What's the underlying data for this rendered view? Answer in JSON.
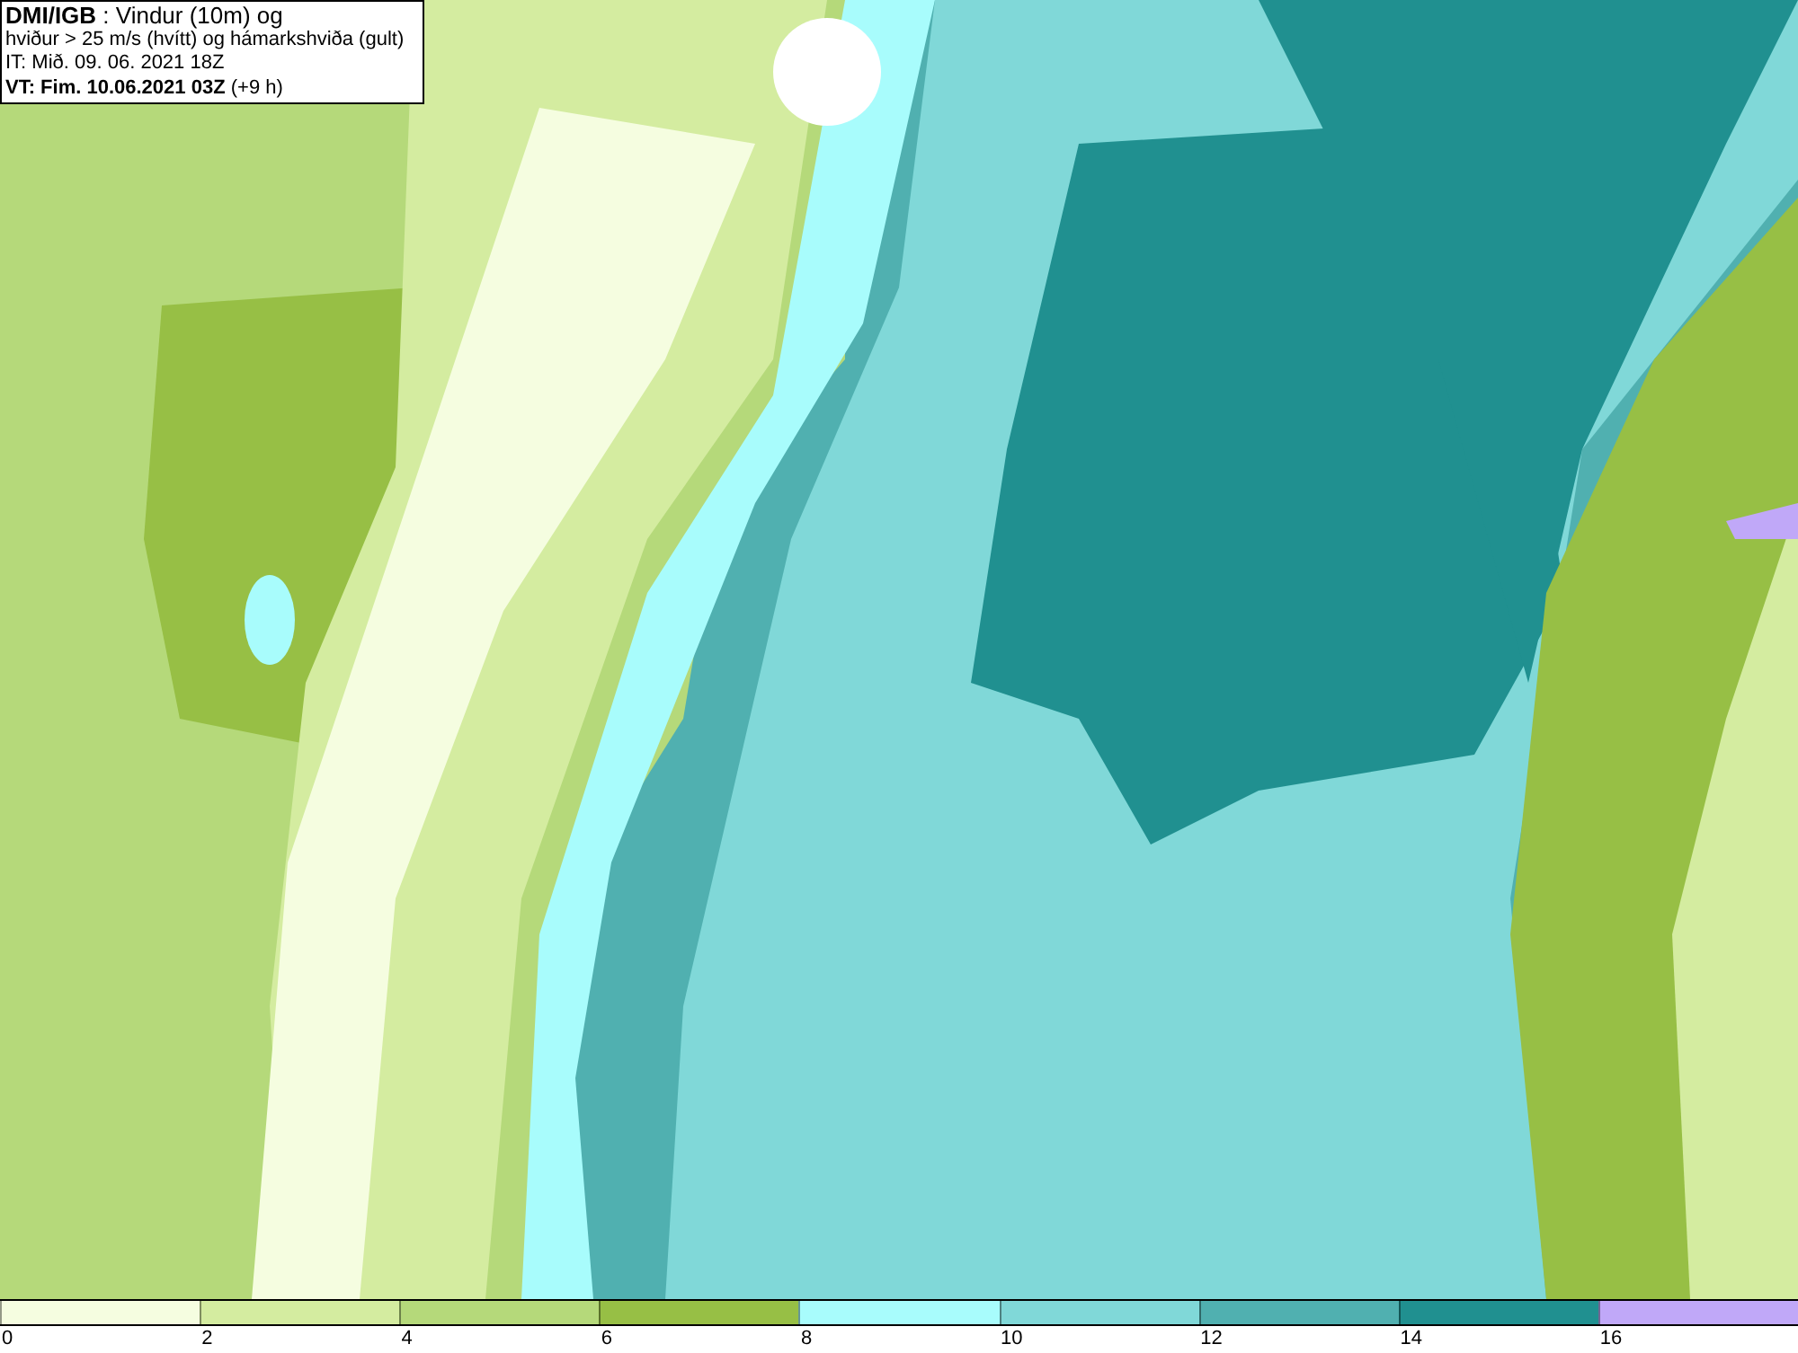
{
  "header": {
    "lines": [
      "**DMI/IGB** : Vindur (10m) og",
      "hviður > 25 m/s (hvítt) og hámarkshviða (gult)",
      "IT: Mið. 09. 06. 2021 18Z",
      "**VT: Fim. 10.06.2021 03Z** (+9 h)"
    ]
  },
  "legend": {
    "bins": [
      {
        "color": "#f5fde0"
      },
      {
        "color": "#d4eca0"
      },
      {
        "color": "#b5d97a"
      },
      {
        "color": "#97bf45"
      },
      {
        "color": "#a8fcfc"
      },
      {
        "color": "#80d8d8"
      },
      {
        "color": "#50b0b0"
      },
      {
        "color": "#209090"
      },
      {
        "color": "#c0a8f8"
      }
    ],
    "labels": [
      "0",
      "2",
      "4",
      "6",
      "8",
      "10",
      "12",
      "14",
      "16"
    ]
  }
}
